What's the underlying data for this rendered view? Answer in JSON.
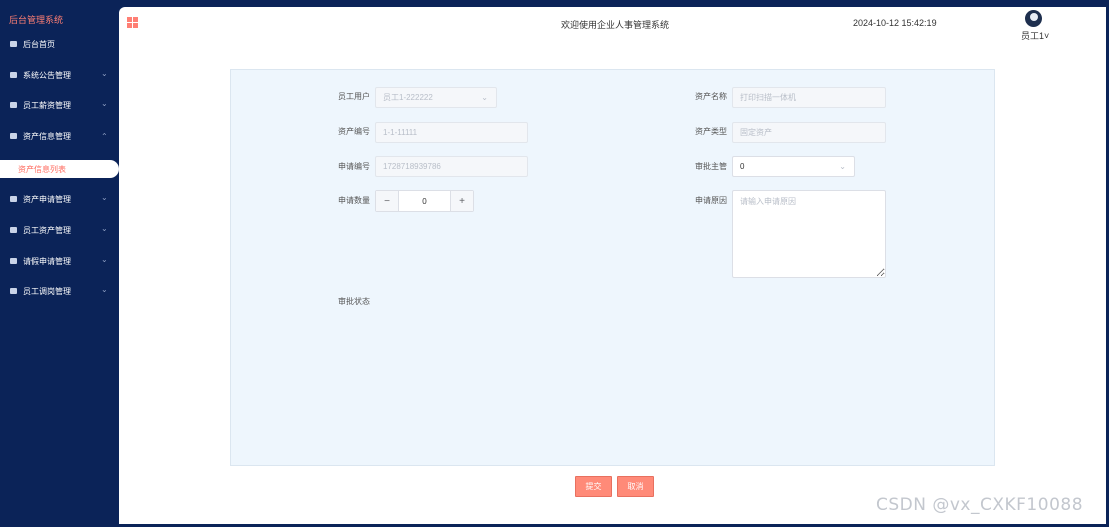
{
  "sidebar": {
    "brand": "后台管理系统",
    "items": [
      {
        "label": "后台首页"
      },
      {
        "label": "系统公告管理"
      },
      {
        "label": "员工薪资管理"
      },
      {
        "label": "资产信息管理"
      },
      {
        "label": "资产申请管理"
      },
      {
        "label": "员工资产管理"
      },
      {
        "label": "请假申请管理"
      },
      {
        "label": "员工调岗管理"
      }
    ],
    "active_sub": "资产信息列表"
  },
  "header": {
    "welcome": "欢迎使用企业人事管理系统",
    "datetime": "2024-10-12 15:42:19",
    "user": "员工1"
  },
  "form": {
    "employee_label": "员工用户",
    "employee_value": "员工1-222222",
    "asset_name_label": "资产名称",
    "asset_name_value": "打印扫描一体机",
    "asset_no_label": "资产编号",
    "asset_no_value": "1-1-11111",
    "asset_type_label": "资产类型",
    "asset_type_value": "固定资产",
    "apply_no_label": "申请编号",
    "apply_no_value": "1728718939786",
    "approver_label": "审批主管",
    "approver_value": "0",
    "quantity_label": "申请数量",
    "quantity_value": "0",
    "reason_label": "申请原因",
    "reason_placeholder": "请输入申请原因",
    "status_label": "审批状态"
  },
  "actions": {
    "submit": "提交",
    "cancel": "取消"
  },
  "watermark": "CSDN @vx_CXKF10088",
  "colors": {
    "sidebar_bg": "#0b2358",
    "accent": "#ff7f74",
    "panel_bg": "#eef6fd"
  }
}
